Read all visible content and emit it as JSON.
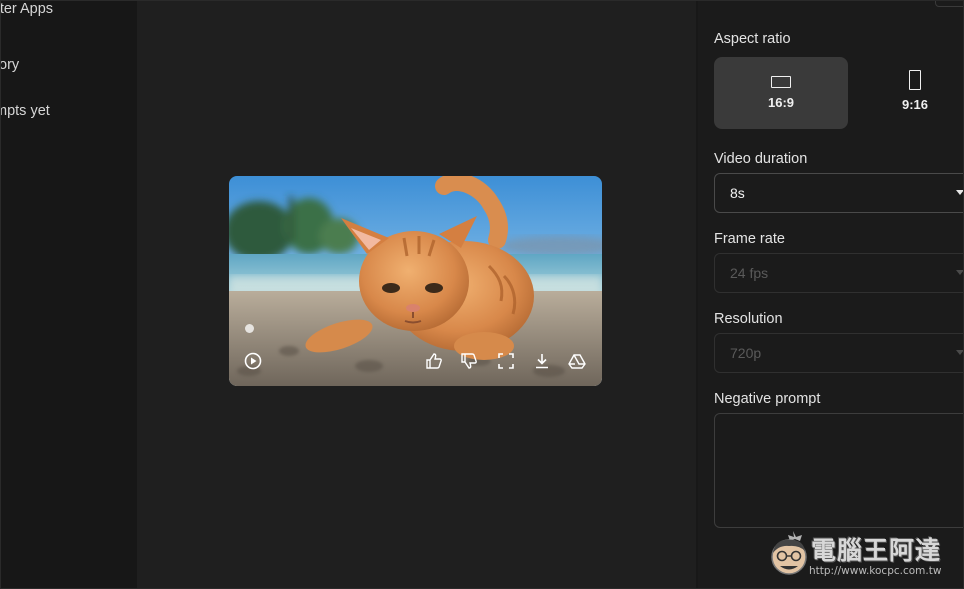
{
  "sidebar": {
    "items": [
      {
        "label": "rter Apps"
      },
      {
        "label": "tory"
      },
      {
        "label": "mpts yet"
      }
    ]
  },
  "video": {
    "controls": [
      "play-icon",
      "thumbs-up-icon",
      "thumbs-down-icon",
      "fullscreen-icon",
      "download-icon",
      "drive-icon"
    ]
  },
  "panel": {
    "aspect_ratio": {
      "label": "Aspect ratio",
      "options": [
        {
          "label": "16:9",
          "selected": true
        },
        {
          "label": "9:16",
          "selected": false
        }
      ]
    },
    "video_duration": {
      "label": "Video duration",
      "value": "8s"
    },
    "frame_rate": {
      "label": "Frame rate",
      "value": "24 fps",
      "disabled": true
    },
    "resolution": {
      "label": "Resolution",
      "value": "720p",
      "disabled": true
    },
    "negative_prompt": {
      "label": "Negative prompt",
      "value": ""
    }
  },
  "watermark": {
    "title": "電腦王阿達",
    "url": "http://www.kocpc.com.tw"
  },
  "colors": {
    "background": "#1f1f1f",
    "sidebar": "#171717",
    "panel": "#1b1b1b",
    "selected_card": "#3a3a3a"
  }
}
